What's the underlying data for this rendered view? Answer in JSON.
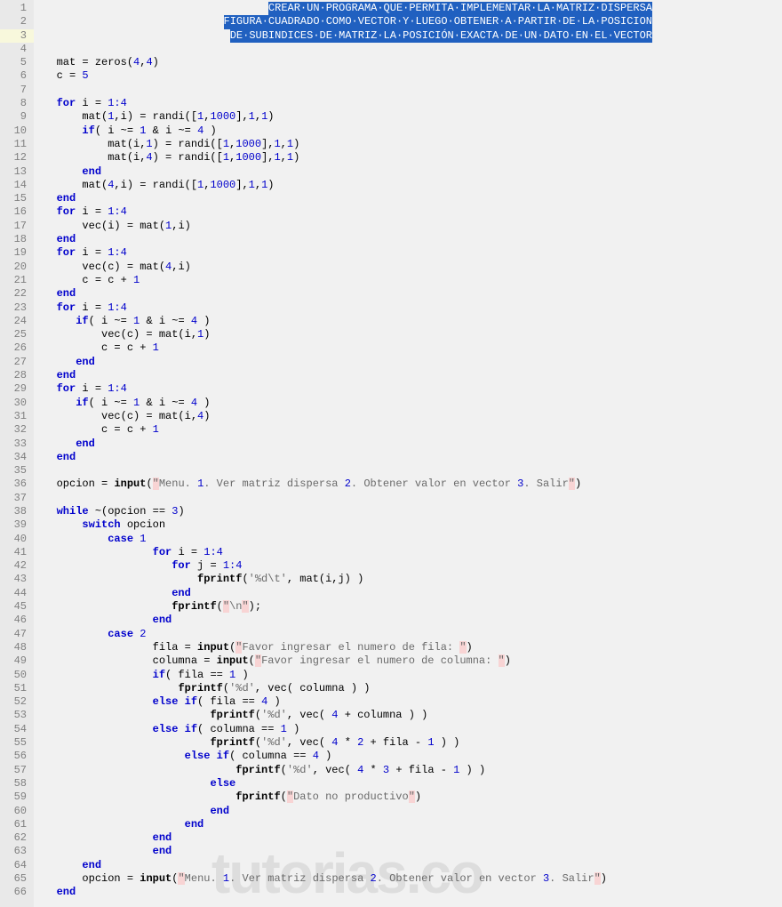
{
  "watermark": "tutorias.co",
  "gutter": {
    "start": 1,
    "end": 66,
    "current": 3
  },
  "selected_comment": {
    "l1": "CREAR·UN·PROGRAMA·QUE·PERMITA·IMPLEMENTAR·LA·MATRIZ·DISPERSA",
    "l2": "FIGURA·CUADRADO·COMO·VECTOR·Y·LUEGO·OBTENER·A·PARTIR·DE·LA·POSICION",
    "l3": "DE·SUBINDICES·DE·MATRIZ·LA·POSICIÓN·EXACTA·DE·UN·DATO·EN·EL·VECTOR"
  },
  "code": {
    "l5": {
      "var": "mat",
      "eq": " = ",
      "fn": "zeros",
      "args": [
        "4",
        "4"
      ]
    },
    "l6": {
      "var": "c",
      "eq": " = ",
      "val": "5"
    },
    "l8_for": "for",
    "l8_var": "i",
    "l8_range": "1:4",
    "l9": {
      "lhs": "mat(",
      "a1": "1",
      "a2": "i",
      "rhs": ") = randi([",
      "n1": "1",
      "n2": "1000",
      "tail": "],",
      "t1": "1",
      "t2": "1",
      "close": ")"
    },
    "l10_if": "if",
    "l10_cond_a": "i ~= ",
    "l10_n1": "1",
    "l10_amp": " & ",
    "l10_cond_b": "i ~= ",
    "l10_n2": "4",
    "l11": {
      "lhs": "mat(i,",
      "a2": "1",
      "rhs": ") = randi([",
      "n1": "1",
      "n2": "1000",
      "tail": "],",
      "t1": "1",
      "t2": "1",
      "close": ")"
    },
    "l12": {
      "lhs": "mat(i,",
      "a2": "4",
      "rhs": ") = randi([",
      "n1": "1",
      "n2": "1000",
      "tail": "],",
      "t1": "1",
      "t2": "1",
      "close": ")"
    },
    "l13_end": "end",
    "l14": {
      "lhs": "mat(",
      "a1": "4",
      "a2": "i",
      "rhs": ") = randi([",
      "n1": "1",
      "n2": "1000",
      "tail": "],",
      "t1": "1",
      "t2": "1",
      "close": ")"
    },
    "l15_end": "end",
    "l16_for": "for",
    "l16_var": "i",
    "l16_range": "1:4",
    "l17": {
      "txt": "vec(i) = mat(",
      "n1": "1",
      "mid": ",i)"
    },
    "l18_end": "end",
    "l19_for": "for",
    "l19_var": "i",
    "l19_range": "1:4",
    "l20": {
      "txt": "vec(c) = mat(",
      "n1": "4",
      "mid": ",i)"
    },
    "l21": {
      "txt": "c = c + ",
      "n1": "1"
    },
    "l22_end": "end",
    "l23_for": "for",
    "l23_var": "i",
    "l23_range": "1:4",
    "l24_if": "if",
    "l24_c": "( i ~= ",
    "l24_n1": "1",
    "l24_amp": " & i ~= ",
    "l24_n2": "4",
    "l24_close": " )",
    "l25": {
      "txt": "vec(c) = mat(i,",
      "n1": "1",
      "mid": ")"
    },
    "l26": {
      "txt": "c = c + ",
      "n1": "1"
    },
    "l27_end": "end",
    "l28_end": "end",
    "l29_for": "for",
    "l29_var": "i",
    "l29_range": "1:4",
    "l30_if": "if",
    "l30_c": "( i ~= ",
    "l30_n1": "1",
    "l30_amp": " & i ~= ",
    "l30_n2": "4",
    "l30_close": " )",
    "l31": {
      "txt": "vec(c) = mat(i,",
      "n1": "4",
      "mid": ")"
    },
    "l32": {
      "txt": "c = c + ",
      "n1": "1"
    },
    "l33_end": "end",
    "l34_end": "end",
    "l36_var": "opcion",
    "l36_eq": " = ",
    "l36_fn": "input",
    "l36_q": "\"",
    "l36_str": "Menu. ",
    "l36_n1": "1",
    "l36_s1": ". Ver matriz dispersa ",
    "l36_n2": "2",
    "l36_s2": ". Obtener valor en vector ",
    "l36_n3": "3",
    "l36_s3": ". Salir",
    "l38_while": "while",
    "l38_cond": " ~(opcion == ",
    "l38_n": "3",
    "l38_close": ")",
    "l39_switch": "switch",
    "l39_var": " opcion",
    "l40_case": "case",
    "l40_n": "1",
    "l41_for": "for",
    "l41_var": "i",
    "l41_range": "1:4",
    "l42_for": "for",
    "l42_var": "j",
    "l42_range": "1:4",
    "l43_fn": "fprintf",
    "l43_fmt": "'%d\\t'",
    "l43_arg": ", mat(i,j) )",
    "l44_end": "end",
    "l45_fn": "fprintf",
    "l45_q": "\"",
    "l45_str": "\\n",
    "l45_close": ");",
    "l46_end": "end",
    "l47_case": "case",
    "l47_n": "2",
    "l48_var": "fila",
    "l48_eq": " = ",
    "l48_fn": "input",
    "l48_q": "\"",
    "l48_str": "Favor ingresar el numero de fila: ",
    "l49_var": "columna",
    "l49_eq": " = ",
    "l49_fn": "input",
    "l49_q": "\"",
    "l49_str": "Favor ingresar el numero de columna: ",
    "l50_if": "if",
    "l50_c": "( fila == ",
    "l50_n": "1",
    "l50_close": " )",
    "l51_fn": "fprintf",
    "l51_fmt": "'%d'",
    "l51_arg": ", vec( columna ) )",
    "l52_else": "else",
    "l52_if": "if",
    "l52_c": "( fila == ",
    "l52_n": "4",
    "l52_close": " )",
    "l53_fn": "fprintf",
    "l53_fmt": "'%d'",
    "l53_arg_a": ", vec( ",
    "l53_n": "4",
    "l53_arg_b": " + columna ) )",
    "l54_else": "else",
    "l54_if": "if",
    "l54_c": "( columna == ",
    "l54_n": "1",
    "l54_close": " )",
    "l55_fn": "fprintf",
    "l55_fmt": "'%d'",
    "l55_arg_a": ", vec( ",
    "l55_n1": "4",
    "l55_mid": " * ",
    "l55_n2": "2",
    "l55_mid2": " + fila - ",
    "l55_n3": "1",
    "l55_close": " ) )",
    "l56_else": "else",
    "l56_if": "if",
    "l56_c": "( columna == ",
    "l56_n": "4",
    "l56_close": " )",
    "l57_fn": "fprintf",
    "l57_fmt": "'%d'",
    "l57_arg_a": ", vec( ",
    "l57_n1": "4",
    "l57_mid": " * ",
    "l57_n2": "3",
    "l57_mid2": " + fila - ",
    "l57_n3": "1",
    "l57_close": " ) )",
    "l58_else": "else",
    "l59_fn": "fprintf",
    "l59_q": "\"",
    "l59_str": "Dato no productivo",
    "l60_end": "end",
    "l61_end": "end",
    "l62_end": "end",
    "l63_end": "end",
    "l64_end": "end",
    "l65_var": "opcion",
    "l65_eq": " = ",
    "l65_fn": "input",
    "l65_q": "\"",
    "l65_str": "Menu. ",
    "l65_n1": "1",
    "l65_s1": ". Ver matriz dispersa ",
    "l65_n2": "2",
    "l65_s2": ". Obtener valor en vector ",
    "l65_n3": "3",
    "l65_s3": ". Salir",
    "l66_end": "end"
  }
}
